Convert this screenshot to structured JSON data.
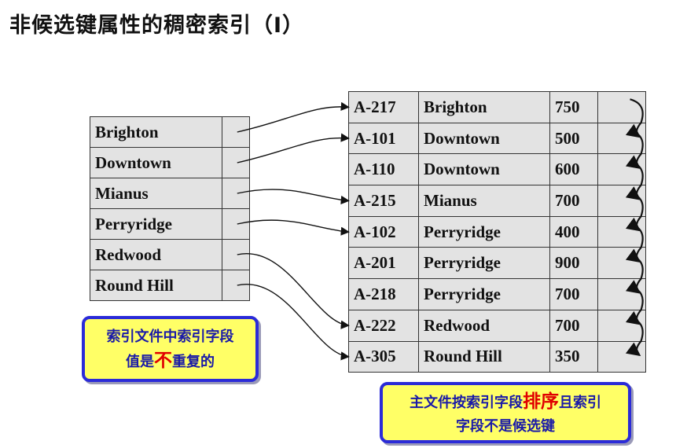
{
  "title": "非候选键属性的稠密索引（I）",
  "index_entries": [
    "Brighton",
    "Downtown",
    "Mianus",
    "Perryridge",
    "Redwood",
    "Round Hill"
  ],
  "records": [
    {
      "account": "A-217",
      "branch": "Brighton",
      "balance": "750"
    },
    {
      "account": "A-101",
      "branch": "Downtown",
      "balance": "500"
    },
    {
      "account": "A-110",
      "branch": "Downtown",
      "balance": "600"
    },
    {
      "account": "A-215",
      "branch": "Mianus",
      "balance": "700"
    },
    {
      "account": "A-102",
      "branch": "Perryridge",
      "balance": "400"
    },
    {
      "account": "A-201",
      "branch": "Perryridge",
      "balance": "900"
    },
    {
      "account": "A-218",
      "branch": "Perryridge",
      "balance": "700"
    },
    {
      "account": "A-222",
      "branch": "Redwood",
      "balance": "700"
    },
    {
      "account": "A-305",
      "branch": "Round Hill",
      "balance": "350"
    }
  ],
  "index_pointers": [
    0,
    1,
    3,
    4,
    7,
    8
  ],
  "note_left": {
    "line1": "索引文件中索引字段",
    "line2_a": "值是",
    "line2_em": "不",
    "line2_b": "重复的"
  },
  "note_right": {
    "line1_a": "主文件按索引字段",
    "line1_em": "排序",
    "line1_b": "且索引",
    "line2": "字段不是候选键"
  },
  "colors": {
    "note_bg": "#ffff66",
    "note_border": "#2b2bd8",
    "note_text": "#1a1aa8",
    "emphasis": "#e00000",
    "cell_bg": "#e3e3e3"
  }
}
